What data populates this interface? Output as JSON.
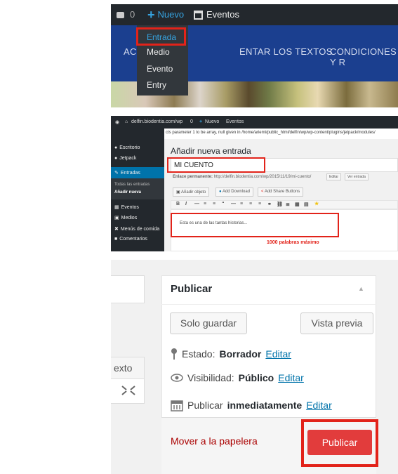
{
  "panel1": {
    "adminbar": {
      "comments_count": "0",
      "new_label": "Nuevo",
      "events_label": "Eventos"
    },
    "nav": {
      "item1": "AC",
      "item2": "ENTAR LOS TEXTOS",
      "item3": "CONDICIONES Y R"
    },
    "dropdown": [
      "Entrada",
      "Medio",
      "Evento",
      "Entry"
    ]
  },
  "panel2": {
    "adminbar": {
      "site": "delfin.biodentia.com/wp",
      "comments_count": "0",
      "new_label": "Nuevo",
      "events_label": "Eventos"
    },
    "notice": "cts parameter 1 to be array, null given in /home/ariemi/public_html/delfin/wp/wp-content/plugins/jetpack/modules/",
    "sidebar": {
      "items": [
        "Escritorio",
        "Jetpack",
        "Entradas",
        "Eventos",
        "Medios",
        "Menús de comida",
        "Comentarios"
      ],
      "subitems": [
        "Todas las entradas",
        "Añadir nueva"
      ]
    },
    "heading": "Añadir nueva entrada",
    "title_value": "MI CUENTO",
    "permalink_label": "Enlace permanente:",
    "permalink_url": "http://delfin.biodentia.com/wp/2015/11/19/mi-cuento/",
    "permalink_edit": "Editar",
    "permalink_view": "Ver entrada",
    "media_buttons": [
      "Añadir objeto",
      "Add Download",
      "Add Share Buttons"
    ],
    "toolbar": [
      "B",
      "I",
      "—",
      "≡",
      "≡",
      "“",
      "—",
      "≡",
      "≡",
      "≡",
      "⚭",
      "⛓",
      "≣",
      "▦",
      "▤",
      "★"
    ],
    "editor_text": "Esta es una de las tantas historias...",
    "word_limit": "1000 palabras máximo"
  },
  "panel3": {
    "tab_text": "exto",
    "box_title": "Publicar",
    "save_draft": "Solo guardar",
    "preview": "Vista previa",
    "status_label": "Estado:",
    "status_value": "Borrador",
    "visibility_label": "Visibilidad:",
    "visibility_value": "Público",
    "publish_label": "Publicar",
    "publish_value": "inmediatamente",
    "edit_link": "Editar",
    "trash": "Mover a la papelera",
    "publish_button": "Publicar"
  },
  "colors": {
    "adminbar": "#23282d",
    "accent_blue": "#0073aa",
    "highlight_red": "#e2231a",
    "publish_button": "#e23c3c"
  }
}
